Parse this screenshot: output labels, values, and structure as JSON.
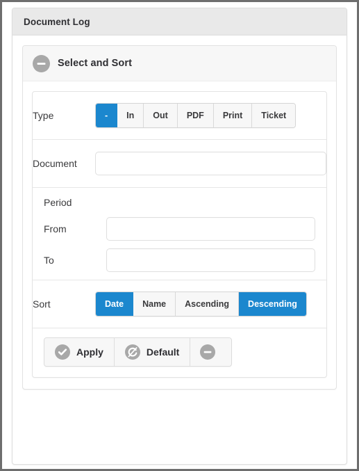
{
  "window": {
    "title": "Document Log"
  },
  "section": {
    "title": "Select and Sort",
    "collapse_icon": "minus-circle-icon"
  },
  "form": {
    "type_row": {
      "label": "Type",
      "options": [
        {
          "label": "-",
          "active": true
        },
        {
          "label": "In",
          "active": false
        },
        {
          "label": "Out",
          "active": false
        },
        {
          "label": "PDF",
          "active": false
        },
        {
          "label": "Print",
          "active": false
        },
        {
          "label": "Ticket",
          "active": false
        }
      ]
    },
    "document_row": {
      "label": "Document",
      "value": "",
      "placeholder": ""
    },
    "period": {
      "label": "Period",
      "from": {
        "label": "From",
        "value": "",
        "placeholder": ""
      },
      "to": {
        "label": "To",
        "value": "",
        "placeholder": ""
      }
    },
    "sort_row": {
      "label": "Sort",
      "options": [
        {
          "label": "Date",
          "active": true
        },
        {
          "label": "Name",
          "active": false
        },
        {
          "label": "Ascending",
          "active": false
        },
        {
          "label": "Descending",
          "active": true
        }
      ]
    }
  },
  "actions": {
    "apply": {
      "label": "Apply",
      "icon": "check-circle-icon"
    },
    "default": {
      "label": "Default",
      "icon": "reset-circle-icon"
    },
    "collapse": {
      "label": "",
      "icon": "minus-circle-icon"
    }
  },
  "colors": {
    "accent": "#1b87ce",
    "icon_grey": "#a8a8a8",
    "header_bg": "#e9e9e9",
    "section_bg": "#f7f7f7",
    "text": "#2f2f33"
  }
}
